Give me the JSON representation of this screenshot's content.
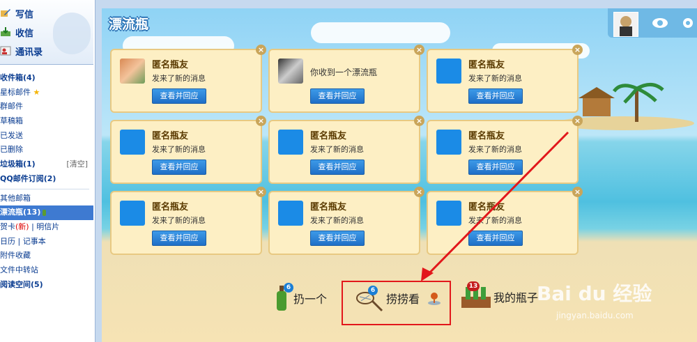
{
  "sidebar": {
    "top_items": [
      {
        "label": "写信",
        "icon": "pen-icon"
      },
      {
        "label": "收信",
        "icon": "inbox-icon"
      },
      {
        "label": "通讯录",
        "icon": "contacts-icon"
      }
    ],
    "nav": [
      {
        "label": "收件箱(4)",
        "bold": true
      },
      {
        "label": "星标邮件",
        "star": true
      },
      {
        "label": "群邮件"
      },
      {
        "label": "草稿箱"
      },
      {
        "label": "已发送"
      },
      {
        "label": "已删除"
      },
      {
        "label": "垃圾箱(1)",
        "bold": true,
        "extra": "[清空]"
      },
      {
        "label": "QQ邮件订阅(2)",
        "bold": true
      },
      {
        "label": "其他邮箱"
      },
      {
        "label": "漂流瓶(13)",
        "selected": true
      },
      {
        "label": "贺卡",
        "new": "(新)",
        "second": "明信片"
      },
      {
        "label": "日历",
        "second": "记事本"
      },
      {
        "label": "附件收藏"
      },
      {
        "label": "文件中转站"
      },
      {
        "label": "阅读空间(5)",
        "bold": true
      }
    ]
  },
  "scene": {
    "logo": "漂流瓶",
    "cards": [
      {
        "name": "匿名瓶友",
        "msg": "发来了新的消息",
        "button": "查看并回应",
        "avatar": "photo1"
      },
      {
        "name": "",
        "msg": "你收到一个漂流瓶",
        "button": "查看并回应",
        "avatar": "photo2"
      },
      {
        "name": "匿名瓶友",
        "msg": "发来了新的消息",
        "button": "查看并回应",
        "avatar": "qq"
      },
      {
        "name": "匿名瓶友",
        "msg": "发来了新的消息",
        "button": "查看并回应",
        "avatar": "qq"
      },
      {
        "name": "匿名瓶友",
        "msg": "发来了新的消息",
        "button": "查看并回应",
        "avatar": "qq"
      },
      {
        "name": "匿名瓶友",
        "msg": "发来了新的消息",
        "button": "查看并回应",
        "avatar": "qq"
      },
      {
        "name": "匿名瓶友",
        "msg": "发来了新的消息",
        "button": "查看并回应",
        "avatar": "qq"
      },
      {
        "name": "匿名瓶友",
        "msg": "发来了新的消息",
        "button": "查看并回应",
        "avatar": "qq"
      },
      {
        "name": "匿名瓶友",
        "msg": "发来了新的消息",
        "button": "查看并回应",
        "avatar": "qq"
      }
    ],
    "close_glyph": "×",
    "actions": {
      "throw": {
        "label": "扔一个",
        "badge": "6"
      },
      "fish": {
        "label": "捞捞看",
        "badge": "6"
      },
      "mine": {
        "label": "我的瓶子",
        "badge": "13"
      }
    }
  },
  "watermark": {
    "main": "Bai du 经验",
    "sub": "jingyan.baidu.com"
  },
  "colors": {
    "accent": "#1f6fc7",
    "highlight": "#e2171b",
    "card_bg": "#fdefc4"
  }
}
